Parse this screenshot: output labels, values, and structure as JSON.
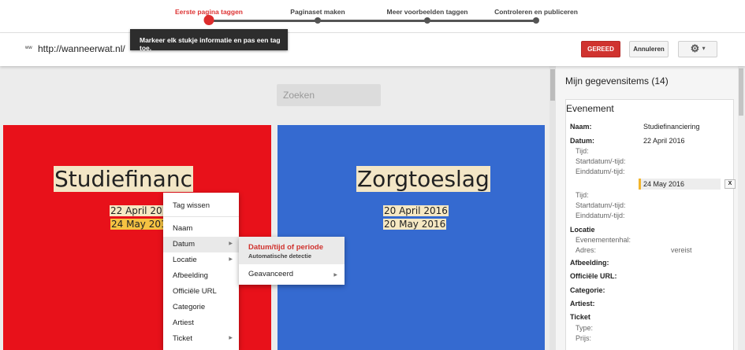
{
  "wizard": {
    "steps": [
      {
        "label": "Eerste pagina taggen",
        "active": true
      },
      {
        "label": "Paginaset maken",
        "active": false
      },
      {
        "label": "Meer voorbeelden taggen",
        "active": false
      },
      {
        "label": "Controleren en publiceren",
        "active": false
      }
    ],
    "tooltip": "Markeer elk stukje informatie en pas een tag toe."
  },
  "header": {
    "url_icon": "ww",
    "url": "http://wanneerwat.nl/",
    "done_label": "GEREED",
    "cancel_label": "Annuleren",
    "settings_icon": "gear-icon"
  },
  "page": {
    "search_placeholder": "Zoeken",
    "cards": [
      {
        "title": "Studiefinanc",
        "dates": [
          "22 April 2016",
          "24 May 2016"
        ],
        "color": "#e8111a"
      },
      {
        "title": "Zorgtoeslag",
        "dates": [
          "20 April 2016",
          "20 May 2016"
        ],
        "color": "#356ad0"
      }
    ]
  },
  "context_menu": {
    "items": [
      "Tag wissen",
      "Naam",
      "Datum",
      "Locatie",
      "Afbeelding",
      "Officiële URL",
      "Categorie",
      "Artiest",
      "Ticket"
    ],
    "submenu": {
      "title": "Datum/tijd of periode",
      "subtitle": "Automatische detectie",
      "advanced": "Geavanceerd"
    }
  },
  "panel": {
    "title": "Mijn gegevensitems (14)",
    "event_title": "Evenement",
    "name_label": "Naam:",
    "name_value": "Studiefinanciering",
    "date_label": "Datum:",
    "date_value": "22 April 2016",
    "time_label": "Tijd:",
    "start_label": "Startdatum/-tijd:",
    "end_label": "Einddatum/-tijd:",
    "end_value": "24 May 2016",
    "remove_label": "X",
    "time2_label": "Tijd:",
    "start2_label": "Startdatum/-tijd:",
    "end2_label": "Einddatum/-tijd:",
    "location_label": "Locatie",
    "venue_label": "Evenementenhal:",
    "address_label": "Adres:",
    "address_value": "vereist",
    "image_label": "Afbeelding:",
    "official_url_label": "Officiële URL:",
    "category_label": "Categorie:",
    "artist_label": "Artiest:",
    "ticket_label": "Ticket",
    "type_label": "Type:",
    "price_label": "Prijs:"
  },
  "colors": {
    "accent": "#dd2c2c",
    "highlight": "#f5c242"
  }
}
